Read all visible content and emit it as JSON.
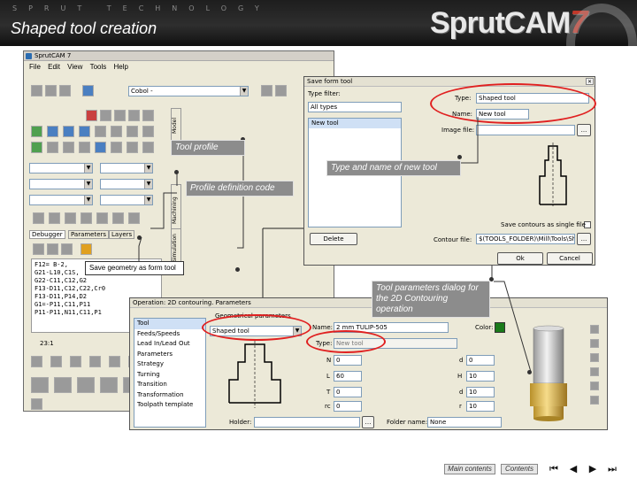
{
  "header": {
    "brand_top": "SPRUT TECHNOLOGY",
    "slide_title": "Shaped tool creation",
    "logo_text": "SprutCAM",
    "logo_version": "7"
  },
  "main_window": {
    "title": "SprutCAM 7",
    "menu": [
      "File",
      "Edit",
      "View",
      "Tools",
      "Help"
    ],
    "model_combo": "Cobol -",
    "vertical_tabs": [
      "Model",
      "Machining",
      "Simulation"
    ],
    "tabs": [
      "Debugger",
      "Parameters",
      "Layers"
    ],
    "code_lines": [
      "F12= B-2,",
      "G21-L10,C1S,",
      "G22-C11,C12,G2",
      "F13-D11,C12,C22,Cr0",
      "F13-D11,P14,D2",
      "G1=-P11,C11,P11",
      "P11-P11,N11,C11,P1"
    ],
    "status_value": "23:1"
  },
  "save_dialog": {
    "title": "Save form tool",
    "type_filter_label": "Type filter:",
    "type_filter_value": "All types",
    "list_items": [
      "New tool"
    ],
    "type_label": "Type:",
    "type_value": "Shaped tool",
    "name_label": "Name:",
    "name_value": "New tool",
    "image_file_label": "Image file:",
    "image_file_button": "...",
    "save_contours_label": "Save contours as single file",
    "delete_button": "Delete",
    "contour_file_label": "Contour file:",
    "contour_file_value": "$(TOOLS_FOLDER)\\Mill\\Tools\\Shap",
    "ok_button": "Ok",
    "cancel_button": "Cancel"
  },
  "params_dialog": {
    "title": "Operation: 2D contouring. Parameters",
    "list_items": [
      "Tool",
      "Feeds/Speeds",
      "Lead In/Lead Out",
      "Parameters",
      "Strategy",
      "Turning",
      "Transition",
      "Transformation",
      "Toolpath template"
    ],
    "geom_group_label": "Geometrical parameters",
    "tool_type_value": "Shaped tool",
    "name_label": "Name:",
    "name_value": "2 mm TULIP-505",
    "type_label": "Type:",
    "type_value": "New tool",
    "color_label": "Color:",
    "color_value": "#1a7a1a",
    "left_fields": [
      {
        "label": "N",
        "value": "0"
      },
      {
        "label": "L",
        "value": "60"
      },
      {
        "label": "T",
        "value": "0"
      },
      {
        "label": "rc",
        "value": "0"
      }
    ],
    "right_fields": [
      {
        "label": "d",
        "value": "0"
      },
      {
        "label": "H",
        "value": "10"
      },
      {
        "label": "d",
        "value": "10"
      },
      {
        "label": "r",
        "value": "10"
      }
    ],
    "holder_label": "Holder:",
    "folder_name_label": "Folder name:",
    "folder_name_value": "None"
  },
  "callouts": {
    "tool_profile": "Tool profile",
    "type_and_name": "Type and name of new tool",
    "profile_definition": "Profile definition code",
    "save_geometry": "Save geometry as form tool",
    "tool_params": "Tool parameters dialog for the 2D Contouring operation"
  },
  "footer": {
    "main_contents": "Main contents",
    "contents": "Contents"
  }
}
